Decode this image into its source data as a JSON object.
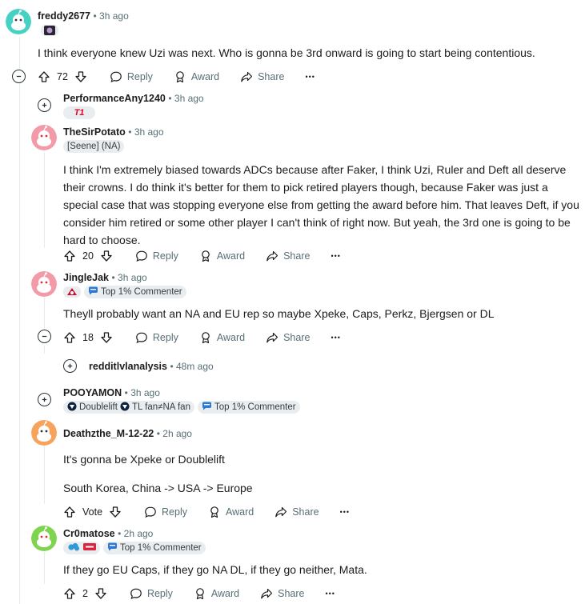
{
  "comments": [
    {
      "username": "freddy2677",
      "time": "3h ago",
      "body": "I think everyone knew Uzi was next. Who is gonna be 3rd onward is going to start being contentious.",
      "votes": "72",
      "reply": "Reply",
      "award": "Award",
      "share": "Share",
      "more": "•••",
      "avatar_color": "#46d1c3"
    },
    {
      "username": "PerformanceAny1240",
      "time": "3h ago",
      "flair_team": "T1"
    },
    {
      "username": "TheSirPotato",
      "time": "3h ago",
      "flair": "[Seene] (NA)",
      "body": "I think I'm extremely biased towards ADCs because after Faker, I think Uzi, Ruler and Deft all deserve their crowns. I do think it's better for them to pick retired players though, because Faker was just a special case that was stopping everyone else from getting the award before him. That leaves Deft, if you consider him retired or some other player I can't think of right now. But yeah, the 3rd one is going to be hard to choose.",
      "votes": "20",
      "reply": "Reply",
      "award": "Award",
      "share": "Share",
      "more": "•••",
      "avatar_color": "#f39aa8"
    },
    {
      "username": "JingleJak",
      "time": "3h ago",
      "flair": "Top 1% Commenter",
      "body": "Theyll probably want an NA and EU rep so maybe Xpeke, Caps, Perkz, Bjergsen or DL",
      "votes": "18",
      "reply": "Reply",
      "award": "Award",
      "share": "Share",
      "more": "•••",
      "avatar_color": "#f39aa8"
    },
    {
      "username": "redditlvlanalysis",
      "time": "48m ago"
    },
    {
      "username": "POOYAMON",
      "time": "3h ago",
      "flair_1": "Doublelift",
      "flair_2": "TL fan≠NA fan",
      "flair_3": "Top 1% Commenter"
    },
    {
      "username": "Deathzthe_M-12-22",
      "time": "2h ago",
      "body_1": "It's gonna be Xpeke or Doublelift",
      "body_2": "South Korea, China -> USA -> Europe",
      "vote_label": "Vote",
      "reply": "Reply",
      "award": "Award",
      "share": "Share",
      "more": "•••",
      "avatar_color": "#f7a35c"
    },
    {
      "username": "Cr0matose",
      "time": "2h ago",
      "flair": "Top 1% Commenter",
      "body": "If they go EU Caps, if they go NA DL, if they go neither, Mata.",
      "votes": "2",
      "reply": "Reply",
      "award": "Award",
      "share": "Share",
      "more": "•••",
      "avatar_color": "#7ed34f"
    }
  ],
  "meta_separator": "•"
}
